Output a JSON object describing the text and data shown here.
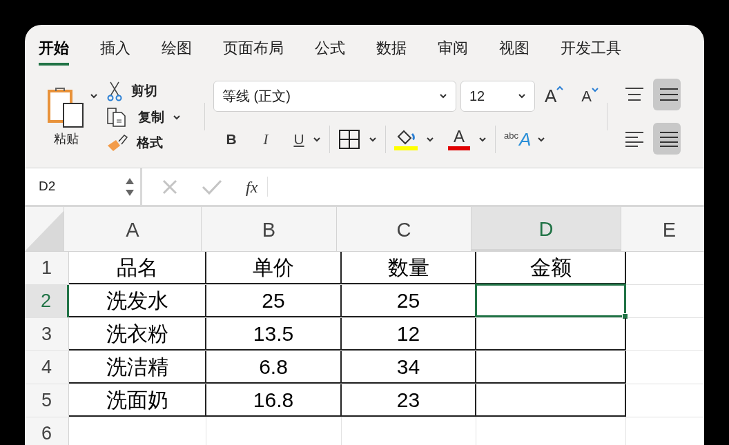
{
  "tabs": [
    {
      "label": "开始",
      "selected": true
    },
    {
      "label": "插入",
      "selected": false
    },
    {
      "label": "绘图",
      "selected": false
    },
    {
      "label": "页面布局",
      "selected": false
    },
    {
      "label": "公式",
      "selected": false
    },
    {
      "label": "数据",
      "selected": false
    },
    {
      "label": "审阅",
      "selected": false
    },
    {
      "label": "视图",
      "selected": false
    },
    {
      "label": "开发工具",
      "selected": false
    }
  ],
  "clipboard": {
    "paste": "粘贴",
    "cut": "剪切",
    "copy": "复制",
    "format": "格式"
  },
  "font": {
    "name": "等线 (正文)",
    "size": "12",
    "grow": "A",
    "shrink": "A",
    "bold": "B",
    "italic": "I",
    "underline": "U",
    "color_glyph": "A",
    "wrap_small": "abc",
    "wrap_big": "A"
  },
  "formula_bar": {
    "name_box": "D2",
    "function_label": "fx"
  },
  "columns": [
    {
      "label": "A",
      "selected": false
    },
    {
      "label": "B",
      "selected": false
    },
    {
      "label": "C",
      "selected": false
    },
    {
      "label": "D",
      "selected": true
    },
    {
      "label": "E",
      "selected": false
    }
  ],
  "rows": [
    {
      "header": "1",
      "selected": false,
      "cells": [
        "品名",
        "单价",
        "数量",
        "金额"
      ]
    },
    {
      "header": "2",
      "selected": true,
      "cells": [
        "洗发水",
        "25",
        "25"
      ]
    },
    {
      "header": "3",
      "selected": false,
      "cells": [
        "洗衣粉",
        "13.5",
        "12"
      ]
    },
    {
      "header": "4",
      "selected": false,
      "cells": [
        "洗洁精",
        "6.8",
        "34"
      ]
    },
    {
      "header": "5",
      "selected": false,
      "cells": [
        "洗面奶",
        "16.8",
        "23"
      ]
    },
    {
      "header": "6",
      "selected": false
    }
  ]
}
